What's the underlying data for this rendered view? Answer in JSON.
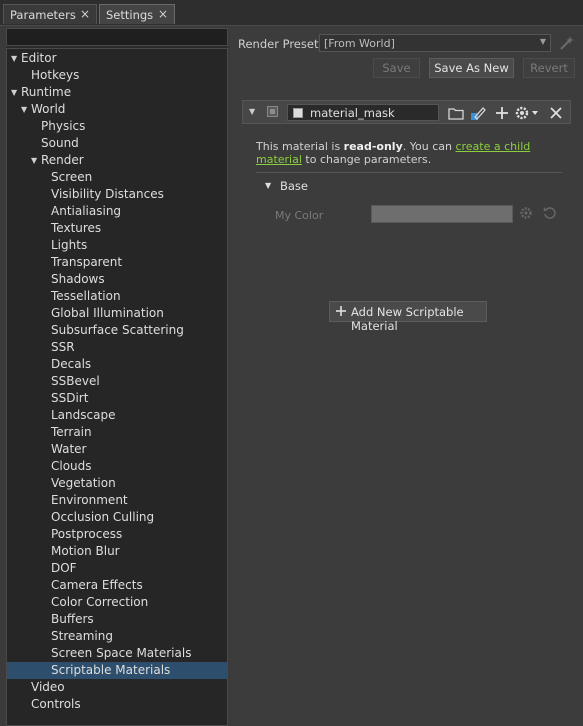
{
  "tabs": [
    {
      "label": "Parameters",
      "close": "×"
    },
    {
      "label": "Settings",
      "close": "×"
    }
  ],
  "tree": {
    "items": [
      {
        "label": "Editor",
        "expanded": true
      },
      {
        "label": "Hotkeys"
      },
      {
        "label": "Runtime",
        "expanded": true
      },
      {
        "label": "World",
        "expanded": true
      },
      {
        "label": "Physics"
      },
      {
        "label": "Sound"
      },
      {
        "label": "Render",
        "expanded": true
      },
      {
        "label": "Screen"
      },
      {
        "label": "Visibility Distances"
      },
      {
        "label": "Antialiasing"
      },
      {
        "label": "Textures"
      },
      {
        "label": "Lights"
      },
      {
        "label": "Transparent"
      },
      {
        "label": "Shadows"
      },
      {
        "label": "Tessellation"
      },
      {
        "label": "Global Illumination"
      },
      {
        "label": "Subsurface Scattering"
      },
      {
        "label": "SSR"
      },
      {
        "label": "Decals"
      },
      {
        "label": "SSBevel"
      },
      {
        "label": "SSDirt"
      },
      {
        "label": "Landscape"
      },
      {
        "label": "Terrain"
      },
      {
        "label": "Water"
      },
      {
        "label": "Clouds"
      },
      {
        "label": "Vegetation"
      },
      {
        "label": "Environment"
      },
      {
        "label": "Occlusion Culling"
      },
      {
        "label": "Postprocess"
      },
      {
        "label": "Motion Blur"
      },
      {
        "label": "DOF"
      },
      {
        "label": "Camera Effects"
      },
      {
        "label": "Color Correction"
      },
      {
        "label": "Buffers"
      },
      {
        "label": "Streaming"
      },
      {
        "label": "Screen Space Materials"
      },
      {
        "label": "Scriptable Materials",
        "selected": true
      },
      {
        "label": "Video"
      },
      {
        "label": "Controls"
      }
    ]
  },
  "render_preset": {
    "label": "Render Preset:",
    "value": "[From World]",
    "icon": "wand-icon"
  },
  "buttons": {
    "save": "Save",
    "save_as_new": "Save As New",
    "revert": "Revert"
  },
  "material": {
    "name": "material_mask",
    "info_prefix": "This material is ",
    "info_bold": "read-only",
    "info_mid": ". You can ",
    "info_link": "create a child material",
    "info_suffix": " to change parameters.",
    "group": "Base",
    "param_label": "My Color",
    "add_button": "Add New Scriptable Material"
  },
  "colors": {
    "accent": "#2d4f6d",
    "link": "#8ccf3e"
  }
}
